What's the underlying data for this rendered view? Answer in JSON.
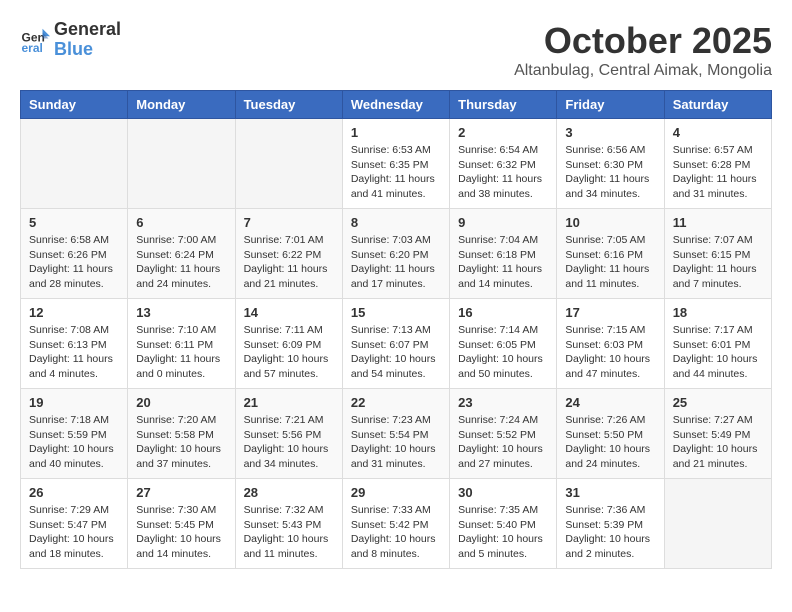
{
  "header": {
    "logo_general": "General",
    "logo_blue": "Blue",
    "month": "October 2025",
    "location": "Altanbulag, Central Aimak, Mongolia"
  },
  "weekdays": [
    "Sunday",
    "Monday",
    "Tuesday",
    "Wednesday",
    "Thursday",
    "Friday",
    "Saturday"
  ],
  "weeks": [
    [
      {
        "day": "",
        "info": ""
      },
      {
        "day": "",
        "info": ""
      },
      {
        "day": "",
        "info": ""
      },
      {
        "day": "1",
        "info": "Sunrise: 6:53 AM\nSunset: 6:35 PM\nDaylight: 11 hours\nand 41 minutes."
      },
      {
        "day": "2",
        "info": "Sunrise: 6:54 AM\nSunset: 6:32 PM\nDaylight: 11 hours\nand 38 minutes."
      },
      {
        "day": "3",
        "info": "Sunrise: 6:56 AM\nSunset: 6:30 PM\nDaylight: 11 hours\nand 34 minutes."
      },
      {
        "day": "4",
        "info": "Sunrise: 6:57 AM\nSunset: 6:28 PM\nDaylight: 11 hours\nand 31 minutes."
      }
    ],
    [
      {
        "day": "5",
        "info": "Sunrise: 6:58 AM\nSunset: 6:26 PM\nDaylight: 11 hours\nand 28 minutes."
      },
      {
        "day": "6",
        "info": "Sunrise: 7:00 AM\nSunset: 6:24 PM\nDaylight: 11 hours\nand 24 minutes."
      },
      {
        "day": "7",
        "info": "Sunrise: 7:01 AM\nSunset: 6:22 PM\nDaylight: 11 hours\nand 21 minutes."
      },
      {
        "day": "8",
        "info": "Sunrise: 7:03 AM\nSunset: 6:20 PM\nDaylight: 11 hours\nand 17 minutes."
      },
      {
        "day": "9",
        "info": "Sunrise: 7:04 AM\nSunset: 6:18 PM\nDaylight: 11 hours\nand 14 minutes."
      },
      {
        "day": "10",
        "info": "Sunrise: 7:05 AM\nSunset: 6:16 PM\nDaylight: 11 hours\nand 11 minutes."
      },
      {
        "day": "11",
        "info": "Sunrise: 7:07 AM\nSunset: 6:15 PM\nDaylight: 11 hours\nand 7 minutes."
      }
    ],
    [
      {
        "day": "12",
        "info": "Sunrise: 7:08 AM\nSunset: 6:13 PM\nDaylight: 11 hours\nand 4 minutes."
      },
      {
        "day": "13",
        "info": "Sunrise: 7:10 AM\nSunset: 6:11 PM\nDaylight: 11 hours\nand 0 minutes."
      },
      {
        "day": "14",
        "info": "Sunrise: 7:11 AM\nSunset: 6:09 PM\nDaylight: 10 hours\nand 57 minutes."
      },
      {
        "day": "15",
        "info": "Sunrise: 7:13 AM\nSunset: 6:07 PM\nDaylight: 10 hours\nand 54 minutes."
      },
      {
        "day": "16",
        "info": "Sunrise: 7:14 AM\nSunset: 6:05 PM\nDaylight: 10 hours\nand 50 minutes."
      },
      {
        "day": "17",
        "info": "Sunrise: 7:15 AM\nSunset: 6:03 PM\nDaylight: 10 hours\nand 47 minutes."
      },
      {
        "day": "18",
        "info": "Sunrise: 7:17 AM\nSunset: 6:01 PM\nDaylight: 10 hours\nand 44 minutes."
      }
    ],
    [
      {
        "day": "19",
        "info": "Sunrise: 7:18 AM\nSunset: 5:59 PM\nDaylight: 10 hours\nand 40 minutes."
      },
      {
        "day": "20",
        "info": "Sunrise: 7:20 AM\nSunset: 5:58 PM\nDaylight: 10 hours\nand 37 minutes."
      },
      {
        "day": "21",
        "info": "Sunrise: 7:21 AM\nSunset: 5:56 PM\nDaylight: 10 hours\nand 34 minutes."
      },
      {
        "day": "22",
        "info": "Sunrise: 7:23 AM\nSunset: 5:54 PM\nDaylight: 10 hours\nand 31 minutes."
      },
      {
        "day": "23",
        "info": "Sunrise: 7:24 AM\nSunset: 5:52 PM\nDaylight: 10 hours\nand 27 minutes."
      },
      {
        "day": "24",
        "info": "Sunrise: 7:26 AM\nSunset: 5:50 PM\nDaylight: 10 hours\nand 24 minutes."
      },
      {
        "day": "25",
        "info": "Sunrise: 7:27 AM\nSunset: 5:49 PM\nDaylight: 10 hours\nand 21 minutes."
      }
    ],
    [
      {
        "day": "26",
        "info": "Sunrise: 7:29 AM\nSunset: 5:47 PM\nDaylight: 10 hours\nand 18 minutes."
      },
      {
        "day": "27",
        "info": "Sunrise: 7:30 AM\nSunset: 5:45 PM\nDaylight: 10 hours\nand 14 minutes."
      },
      {
        "day": "28",
        "info": "Sunrise: 7:32 AM\nSunset: 5:43 PM\nDaylight: 10 hours\nand 11 minutes."
      },
      {
        "day": "29",
        "info": "Sunrise: 7:33 AM\nSunset: 5:42 PM\nDaylight: 10 hours\nand 8 minutes."
      },
      {
        "day": "30",
        "info": "Sunrise: 7:35 AM\nSunset: 5:40 PM\nDaylight: 10 hours\nand 5 minutes."
      },
      {
        "day": "31",
        "info": "Sunrise: 7:36 AM\nSunset: 5:39 PM\nDaylight: 10 hours\nand 2 minutes."
      },
      {
        "day": "",
        "info": ""
      }
    ]
  ]
}
